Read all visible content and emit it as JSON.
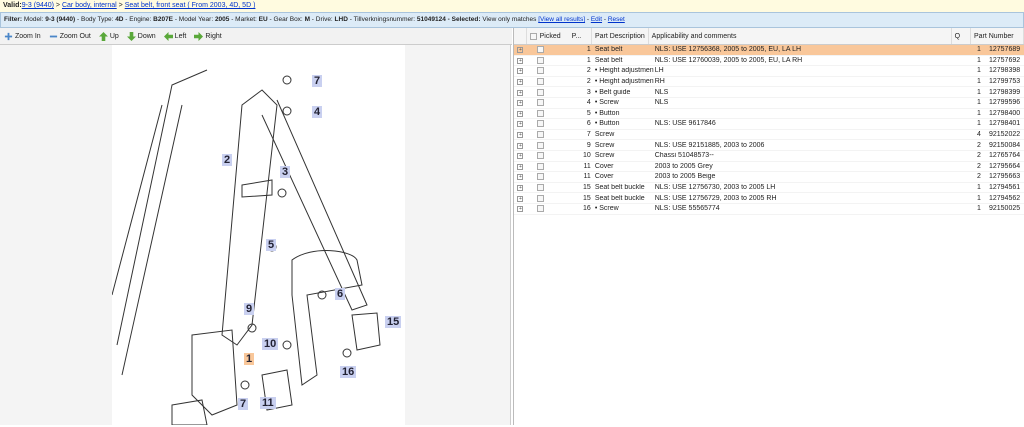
{
  "breadcrumb": {
    "label": "Valid:",
    "items": [
      "9-3 (9440)",
      "Car body, internal",
      "Seat belt, front seat ( From 2003, 4D, 5D )"
    ]
  },
  "filter": {
    "label": "Filter:",
    "text_pre": "Model: ",
    "model": "9-3 (9440)",
    "bt_l": " - Body Type: ",
    "bt": "4D",
    "eng_l": " - Engine: ",
    "eng": "B207E",
    "my_l": " - Model Year: ",
    "my": "2005",
    "mk_l": " - Market: ",
    "mk": "EU",
    "gb_l": " - Gear Box: ",
    "gb": "M",
    "dr_l": " - Drive: ",
    "dr": "LHD",
    "tv_l": " - Tillverkningsnummer: ",
    "tv": "51049124",
    "sel_l": " - Selected:",
    "sel": " View only matches ",
    "view_all": "[View all results]",
    "edit": "Edit",
    "reset": "Reset"
  },
  "toolbar": {
    "zoom_in": "Zoom In",
    "zoom_out": "Zoom Out",
    "up": "Up",
    "down": "Down",
    "left": "Left",
    "right": "Right"
  },
  "table": {
    "headers": {
      "picked": "Picked",
      "pos": "P...",
      "desc": "Part Description",
      "comments": "Applicability and comments",
      "qty": "Q",
      "part": "Part Number"
    },
    "rows": [
      {
        "pos": "1",
        "desc": "Seat belt",
        "comments": "NLS: USE 12756368, 2005 to 2005, EU, LA LH",
        "qty": "1",
        "part": "12757689"
      },
      {
        "pos": "1",
        "desc": "Seat belt",
        "comments": "NLS: USE 12760039, 2005 to 2005, EU, LA RH",
        "qty": "1",
        "part": "12757692"
      },
      {
        "pos": "2",
        "desc": "• Height adjustment",
        "comments": "LH",
        "qty": "1",
        "part": "12798398"
      },
      {
        "pos": "2",
        "desc": "• Height adjustment",
        "comments": "RH",
        "qty": "1",
        "part": "12799753"
      },
      {
        "pos": "3",
        "desc": "• Belt guide",
        "comments": "NLS",
        "qty": "1",
        "part": "12798399"
      },
      {
        "pos": "4",
        "desc": "• Screw",
        "comments": "NLS",
        "qty": "1",
        "part": "12799596"
      },
      {
        "pos": "5",
        "desc": "• Button",
        "comments": "",
        "qty": "1",
        "part": "12798400"
      },
      {
        "pos": "6",
        "desc": "• Button",
        "comments": "NLS: USE 9617846",
        "qty": "1",
        "part": "12798401"
      },
      {
        "pos": "7",
        "desc": "Screw",
        "comments": "",
        "qty": "4",
        "part": "92152022"
      },
      {
        "pos": "9",
        "desc": "Screw",
        "comments": "NLS: USE 92151885, 2003 to 2006",
        "qty": "2",
        "part": "92150084"
      },
      {
        "pos": "10",
        "desc": "Screw",
        "comments": "Chassi 51048573--",
        "qty": "2",
        "part": "12765764"
      },
      {
        "pos": "11",
        "desc": "Cover",
        "comments": "2003 to 2005 Grey",
        "qty": "2",
        "part": "12795664"
      },
      {
        "pos": "11",
        "desc": "Cover",
        "comments": "2003 to 2005 Beige",
        "qty": "2",
        "part": "12795663"
      },
      {
        "pos": "15",
        "desc": "Seat belt buckle",
        "comments": "NLS: USE 12756730, 2003 to 2005 LH",
        "qty": "1",
        "part": "12794561"
      },
      {
        "pos": "15",
        "desc": "Seat belt buckle",
        "comments": "NLS: USE 12756729, 2003 to 2005 RH",
        "qty": "1",
        "part": "12794562"
      },
      {
        "pos": "16",
        "desc": "• Screw",
        "comments": "NLS: USE 55565774",
        "qty": "1",
        "part": "92150025"
      }
    ]
  },
  "callouts": [
    {
      "n": "7",
      "hl": false
    },
    {
      "n": "4",
      "hl": false
    },
    {
      "n": "2",
      "hl": false
    },
    {
      "n": "3",
      "hl": false
    },
    {
      "n": "5",
      "hl": false
    },
    {
      "n": "6",
      "hl": false
    },
    {
      "n": "15",
      "hl": false
    },
    {
      "n": "9",
      "hl": false
    },
    {
      "n": "10",
      "hl": false
    },
    {
      "n": "1",
      "hl": true
    },
    {
      "n": "16",
      "hl": false
    },
    {
      "n": "7",
      "hl": false
    },
    {
      "n": "11",
      "hl": false
    }
  ],
  "colors": {
    "selected_row": "#f9c79a",
    "callout": "#c9d0f0",
    "filter_bg": "#dcebf7"
  }
}
